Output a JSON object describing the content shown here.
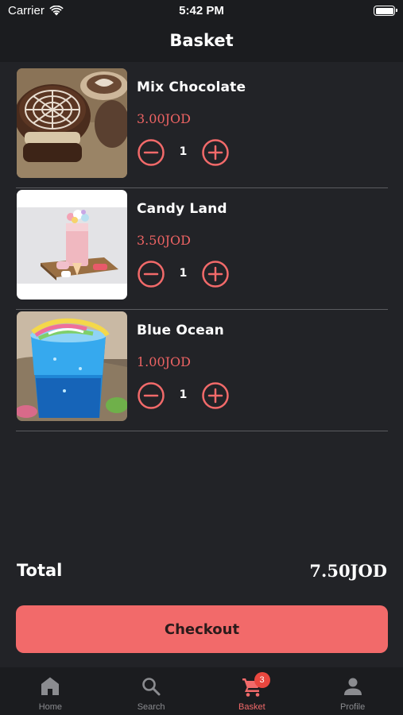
{
  "status_bar": {
    "carrier": "Carrier",
    "time": "5:42 PM"
  },
  "nav": {
    "title": "Basket"
  },
  "colors": {
    "accent": "#f26a6a",
    "price": "#ec6363",
    "background": "#222327",
    "bar": "#1b1c1f"
  },
  "items": [
    {
      "name": "Mix Chocolate",
      "price": "3.00JOD",
      "quantity": "1"
    },
    {
      "name": "Candy Land",
      "price": "3.50JOD",
      "quantity": "1"
    },
    {
      "name": "Blue Ocean",
      "price": "1.00JOD",
      "quantity": "1"
    }
  ],
  "summary": {
    "total_label": "Total",
    "total_value": "7.50JOD"
  },
  "checkout": {
    "label": "Checkout"
  },
  "tabs": [
    {
      "label": "Home",
      "icon": "home-icon"
    },
    {
      "label": "Search",
      "icon": "search-icon"
    },
    {
      "label": "Basket",
      "icon": "cart-icon",
      "badge": "3",
      "active": true
    },
    {
      "label": "Profile",
      "icon": "person-icon"
    }
  ]
}
